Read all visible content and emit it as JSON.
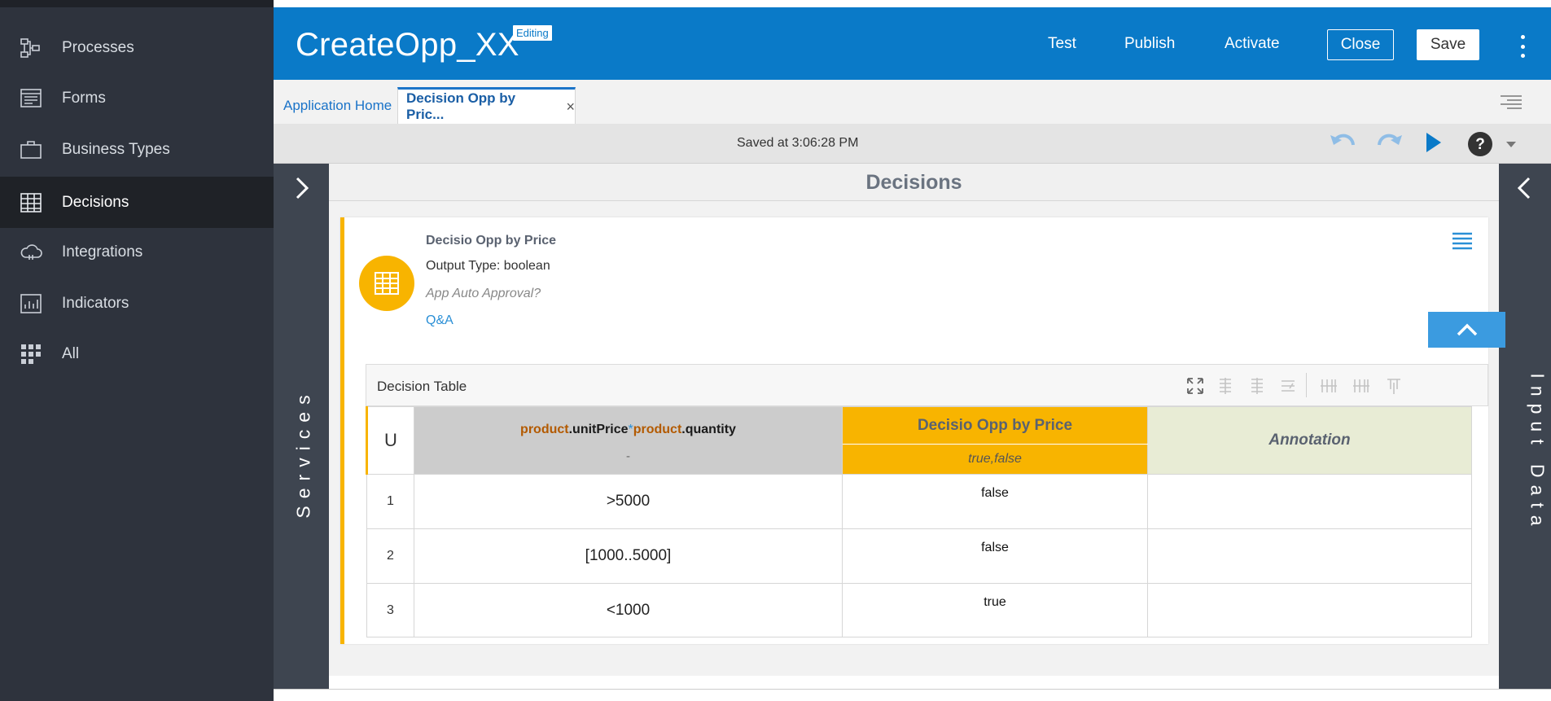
{
  "nav": {
    "items": [
      {
        "label": "Processes",
        "icon": "processes-icon"
      },
      {
        "label": "Forms",
        "icon": "forms-icon"
      },
      {
        "label": "Business Types",
        "icon": "briefcase-icon"
      },
      {
        "label": "Decisions",
        "icon": "table-icon"
      },
      {
        "label": "Integrations",
        "icon": "cloud-icon"
      },
      {
        "label": "Indicators",
        "icon": "chart-icon"
      },
      {
        "label": "All",
        "icon": "grid-icon"
      }
    ],
    "active": "Decisions"
  },
  "header": {
    "title": "CreateOpp_XX",
    "badge": "Editing",
    "test": "Test",
    "publish": "Publish",
    "activate": "Activate",
    "close": "Close",
    "save": "Save"
  },
  "tabs": {
    "home": "Application Home",
    "decision": "Decision Opp by Pric...",
    "close_glyph": "×"
  },
  "toolbar": {
    "saved": "Saved at 3:06:28 PM"
  },
  "rails": {
    "left": "Services",
    "right": "Input Data"
  },
  "main": {
    "title": "Decisions"
  },
  "decision": {
    "name": "Decisio Opp by Price",
    "output_type": "Output Type: boolean",
    "question": "App Auto Approval?",
    "qa": "Q&A"
  },
  "table": {
    "label": "Decision Table",
    "hit_policy": "U",
    "input_expr": {
      "a": "product",
      "b": ".unitPrice",
      "op": "*",
      "c": "product",
      "d": ".quantity"
    },
    "input_values": "-",
    "output_name": "Decisio Opp by Price",
    "output_values": "true,false",
    "annotation": "Annotation",
    "rows": [
      {
        "num": "1",
        "input": ">5000",
        "output": "false",
        "annotation": ""
      },
      {
        "num": "2",
        "input": "[1000..5000]",
        "output": "false",
        "annotation": ""
      },
      {
        "num": "3",
        "input": "<1000",
        "output": "true",
        "annotation": ""
      }
    ]
  },
  "colors": {
    "brand": "#0a7ac8",
    "accent": "#f8b400",
    "nav": "#2e333d"
  }
}
